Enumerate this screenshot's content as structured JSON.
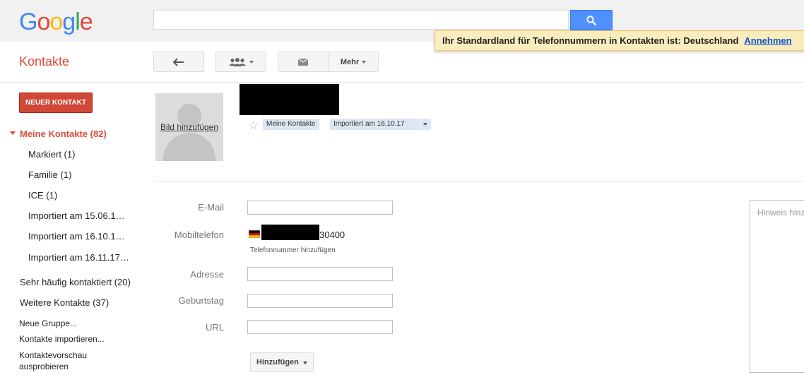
{
  "header": {
    "logo_letters": [
      {
        "ch": "G",
        "color": "#4285f4"
      },
      {
        "ch": "o",
        "color": "#ea4335"
      },
      {
        "ch": "o",
        "color": "#fbbc05"
      },
      {
        "ch": "g",
        "color": "#4285f4"
      },
      {
        "ch": "l",
        "color": "#34a853"
      },
      {
        "ch": "e",
        "color": "#ea4335"
      }
    ],
    "search_value": "",
    "notice_text": "Ihr Standardland für Telefonnummern in Kontakten ist: Deutschland",
    "notice_link": "Annehmen"
  },
  "app": {
    "title": "Kontakte"
  },
  "toolbar": {
    "more_label": "Mehr"
  },
  "sidebar": {
    "new_contact_label": "NEUER KONTAKT",
    "my_contacts": "Meine Kontakte (82)",
    "groups": [
      "Markiert (1)",
      "Familie (1)",
      "ICE (1)",
      "Importiert am 15.06.1…",
      "Importiert am 16.10.1…",
      "Importiert am 16.11.17…"
    ],
    "frequent": "Sehr häufig kontaktiert (20)",
    "other": "Weitere Kontakte (37)",
    "links": [
      "Neue Gruppe...",
      "Kontakte importieren...",
      "Kontaktevorschau ausprobieren"
    ]
  },
  "contact": {
    "add_photo": "Bild hinzufügen",
    "chips": [
      "Meine Kontakte",
      "Importiert am 16.10.17"
    ],
    "fields": {
      "email_label": "E-Mail",
      "email_value": "",
      "mobile_label": "Mobiltelefon",
      "mobile_suffix": "30400",
      "add_phone": "Telefonnummer hinzufügen",
      "address_label": "Adresse",
      "address_value": "",
      "birthday_label": "Geburtstag",
      "birthday_value": "",
      "url_label": "URL",
      "url_value": ""
    },
    "add_button": "Hinzufügen",
    "notes_placeholder": "Hinweis hinzufügen"
  },
  "colors": {
    "accent": "#dd4b39",
    "search_blue": "#4d90fe",
    "notice_bg": "#f9edbe"
  }
}
